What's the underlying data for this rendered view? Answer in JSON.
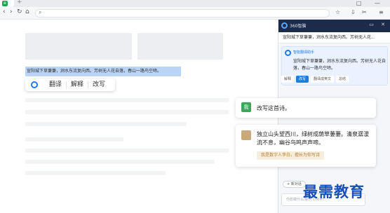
{
  "browser": {
    "tab_plus": "+",
    "window_controls": "□ —",
    "nav": {
      "back": "‹",
      "forward": "›",
      "refresh": "↻",
      "home": "⌂"
    },
    "right_icons": [
      "☆",
      "⇩",
      "✂",
      "≡"
    ]
  },
  "page": {
    "selected_text": "宣阳城下草萋萋，涧水东流复向西。芳树无人花自落，春山一路鸟空啼。"
  },
  "popup": {
    "items": [
      "翻译",
      "解释",
      "改写"
    ]
  },
  "chat": {
    "user_avatar": "我",
    "user_message": "改写这首诗。",
    "reply_text": "独立山头望西川，绿树成荫草萋萋。清泉潺湲流不息，幽谷鸟鸣声声啼。",
    "reply_chip": "我是数字人李白，擅长为你写诗"
  },
  "panel": {
    "title": "360智脑",
    "subtitle": "宣阳城下草萋萋，涧水东流复向西。芳树无人花...",
    "card_name": "智能翻译助手",
    "card_text": "宣阳城下草萋萋，涧水东流复向西。芳树无人花自落，春山一路鸟空啼。",
    "actions": [
      "解释",
      "改写",
      "翻译成英文",
      "总结"
    ],
    "new_chat": "+ 新对话",
    "input_placeholder": "你想做什么/输入 Ctrl+/..."
  },
  "watermark": "最需教育",
  "colors": {
    "accent": "#1f7be0",
    "panel_header": "#1d2b4a",
    "selection": "#b9d4f5",
    "watermark": "#1a4fb8"
  }
}
